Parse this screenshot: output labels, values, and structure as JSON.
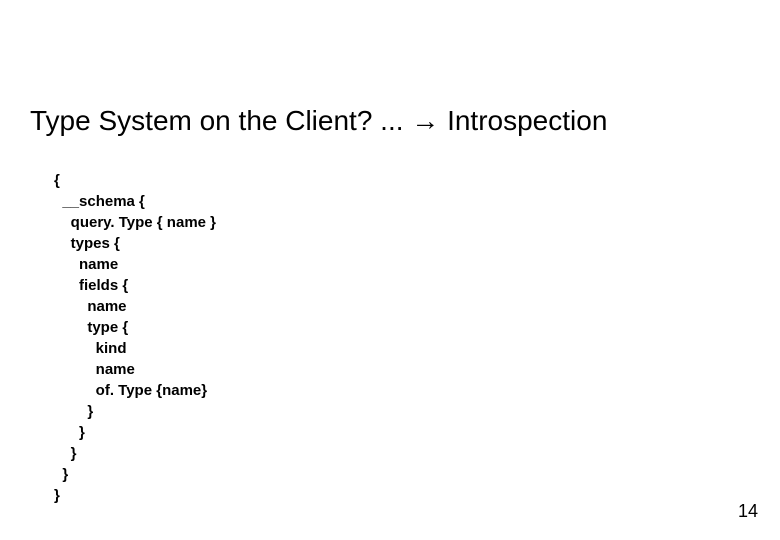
{
  "title": "Type System on the Client? ... → Introspection",
  "code": "{\n  __schema {\n    query. Type { name }\n    types {\n      name\n      fields {\n        name\n        type {\n          kind\n          name\n          of. Type {name}\n        }\n      }\n    }\n  }\n}",
  "page_number": "14"
}
